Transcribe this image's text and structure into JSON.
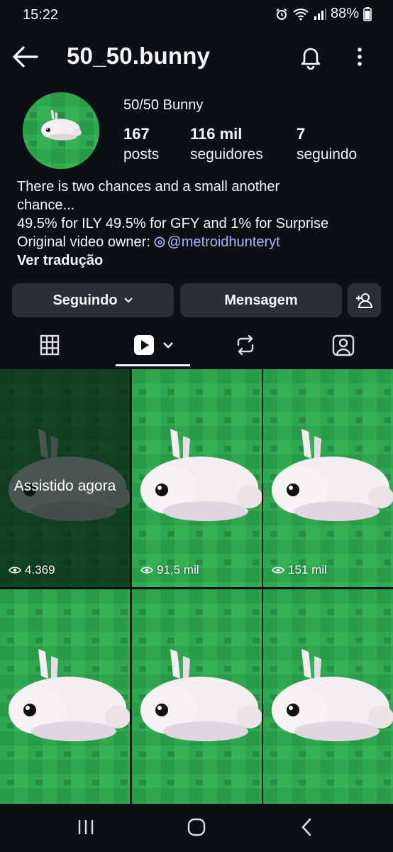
{
  "status": {
    "time": "15:22",
    "battery": "88%"
  },
  "header": {
    "username": "50_50.bunny"
  },
  "profile": {
    "display_name": "50/50 Bunny",
    "stats": [
      {
        "value": "167",
        "label": "posts"
      },
      {
        "value": "116 mil",
        "label": "seguidores"
      },
      {
        "value": "7",
        "label": "seguindo"
      }
    ],
    "bio_lines": [
      "There is two chances and a small another",
      "chance...",
      "49.5% for ILY 49.5% for GFY and 1% for Surprise"
    ],
    "bio_owner_prefix": "Original video owner: ",
    "bio_mention": "@metroidhunteryt",
    "translate_label": "Ver tradução"
  },
  "actions": {
    "following_label": "Seguindo",
    "message_label": "Mensagem"
  },
  "tabs": [
    "grid-icon",
    "reels-icon",
    "reposts-icon",
    "tagged-icon"
  ],
  "reels": [
    {
      "views": "4.369",
      "watched_label": "Assistido agora"
    },
    {
      "views": "91,5 mil"
    },
    {
      "views": "151 mil"
    },
    {
      "views": ""
    },
    {
      "views": ""
    },
    {
      "views": ""
    }
  ],
  "colors": {
    "background": "#0c1014",
    "button": "#2a2f35",
    "mention": "#a6b7ff",
    "thumb_green": "#2fa84f"
  }
}
